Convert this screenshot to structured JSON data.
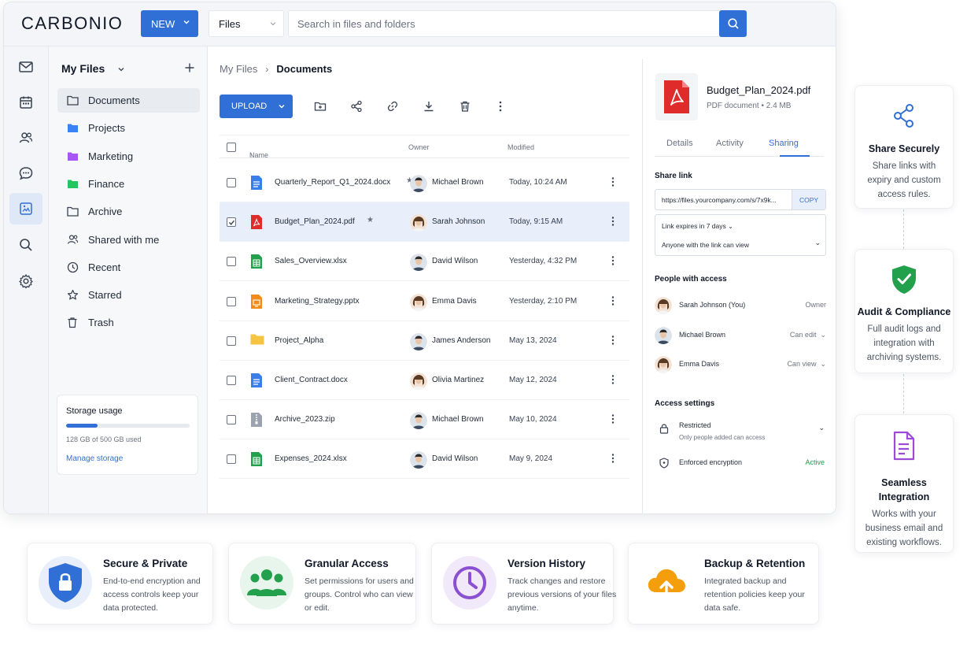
{
  "app": {
    "logo": "CARBONIO",
    "new_label": "NEW",
    "scope_value": "Files",
    "search_placeholder": "Search in files and folders"
  },
  "rail": [
    "mail-icon",
    "calendar-icon",
    "contacts-icon",
    "chat-icon",
    "files-icon",
    "search-icon",
    "settings-icon"
  ],
  "sidebar": {
    "title": "My Files",
    "items": [
      {
        "label": "Documents",
        "icon": "folder-outline-icon",
        "active": true
      },
      {
        "label": "Projects",
        "icon": "folder-blue-icon",
        "color": "#3b82f6"
      },
      {
        "label": "Marketing",
        "icon": "folder-purple-icon",
        "color": "#a855f7"
      },
      {
        "label": "Finance",
        "icon": "folder-green-icon",
        "color": "#22c55e"
      },
      {
        "label": "Archive",
        "icon": "folder-outline-icon"
      },
      {
        "label": "Shared with me",
        "icon": "shared-users-icon"
      },
      {
        "label": "Recent",
        "icon": "clock-icon"
      },
      {
        "label": "Starred",
        "icon": "star-icon"
      },
      {
        "label": "Trash",
        "icon": "trash-icon"
      }
    ],
    "storage": {
      "title": "Storage usage",
      "used_fraction": 0.256,
      "text": "128 GB of 500 GB used",
      "link": "Manage storage"
    }
  },
  "content": {
    "breadcrumb_root": "My Files",
    "breadcrumb_current": "Documents",
    "upload_label": "UPLOAD",
    "columns": {
      "name": "Name",
      "owner": "Owner",
      "modified": "Modified"
    },
    "files": [
      {
        "name": "Quarterly_Report_Q1_2024.docx",
        "type": "docx",
        "starred": true,
        "owner": "Michael Brown",
        "gender": "m",
        "modified": "Today, 10:24 AM",
        "selected": false
      },
      {
        "name": "Budget_Plan_2024.pdf",
        "type": "pdf",
        "starred": true,
        "owner": "Sarah Johnson",
        "gender": "f",
        "modified": "Today, 9:15 AM",
        "selected": true
      },
      {
        "name": "Sales_Overview.xlsx",
        "type": "xlsx",
        "starred": false,
        "owner": "David Wilson",
        "gender": "m",
        "modified": "Yesterday, 4:32 PM",
        "selected": false
      },
      {
        "name": "Marketing_Strategy.pptx",
        "type": "pptx",
        "starred": false,
        "owner": "Emma Davis",
        "gender": "f",
        "modified": "Yesterday, 2:10 PM",
        "selected": false
      },
      {
        "name": "Project_Alpha",
        "type": "folder",
        "starred": false,
        "owner": "James Anderson",
        "gender": "m",
        "modified": "May 13, 2024",
        "selected": false
      },
      {
        "name": "Client_Contract.docx",
        "type": "docx",
        "starred": false,
        "owner": "Olivia Martinez",
        "gender": "f",
        "modified": "May 12, 2024",
        "selected": false
      },
      {
        "name": "Archive_2023.zip",
        "type": "zip",
        "starred": false,
        "owner": "Michael Brown",
        "gender": "m",
        "modified": "May 10, 2024",
        "selected": false
      },
      {
        "name": "Expenses_2024.xlsx",
        "type": "xlsx",
        "starred": false,
        "owner": "David Wilson",
        "gender": "m",
        "modified": "May 9, 2024",
        "selected": false
      }
    ]
  },
  "detail": {
    "filename": "Budget_Plan_2024.pdf",
    "meta": "PDF document • 2.4 MB",
    "tabs": [
      "Details",
      "Activity",
      "Sharing"
    ],
    "active_tab": "Sharing",
    "share_link_title": "Share link",
    "share_url": "https://files.yourcompany.com/s/7x9k...",
    "copy_label": "COPY",
    "expiry": "Link expires in 7 days",
    "visibility": "Anyone with the link can view",
    "people_title": "People with access",
    "people": [
      {
        "name": "Sarah Johnson (You)",
        "role": "Owner",
        "gender": "f",
        "dropdown": false
      },
      {
        "name": "Michael Brown",
        "role": "Can edit",
        "gender": "m",
        "dropdown": true
      },
      {
        "name": "Emma Davis",
        "role": "Can view",
        "gender": "f",
        "dropdown": true
      }
    ],
    "access_title": "Access settings",
    "restricted_label": "Restricted",
    "restricted_sub": "Only people added can access",
    "encryption_label": "Enforced encryption",
    "encryption_status": "Active"
  },
  "side_cards": [
    {
      "title": "Share Securely",
      "desc": "Share links with expiry and custom access rules.",
      "icon": "share-icon",
      "color": "#2f6fd6"
    },
    {
      "title": "Audit & Compliance",
      "desc": "Full audit logs and integration with archiving systems.",
      "icon": "shield-check-icon",
      "color": "#22a04b"
    },
    {
      "title": "Seamless Integration",
      "desc": "Works with your business email and existing workflows.",
      "icon": "document-icon",
      "color": "#9b4bd6"
    }
  ],
  "bottom_cards": [
    {
      "title": "Secure & Private",
      "desc": "End-to-end encryption and access controls keep your data protected.",
      "icon": "shield-lock-icon",
      "color": "#2f6fd6"
    },
    {
      "title": "Granular Access",
      "desc": "Set permissions for users and groups. Control who can view or edit.",
      "icon": "users-icon",
      "color": "#22a04b"
    },
    {
      "title": "Version History",
      "desc": "Track changes and restore previous versions of your files anytime.",
      "icon": "clock-icon",
      "color": "#8b4fd1"
    },
    {
      "title": "Backup & Retention",
      "desc": "Integrated backup and retention policies keep your data safe.",
      "icon": "cloud-upload-icon",
      "color": "#f59e0b"
    }
  ]
}
